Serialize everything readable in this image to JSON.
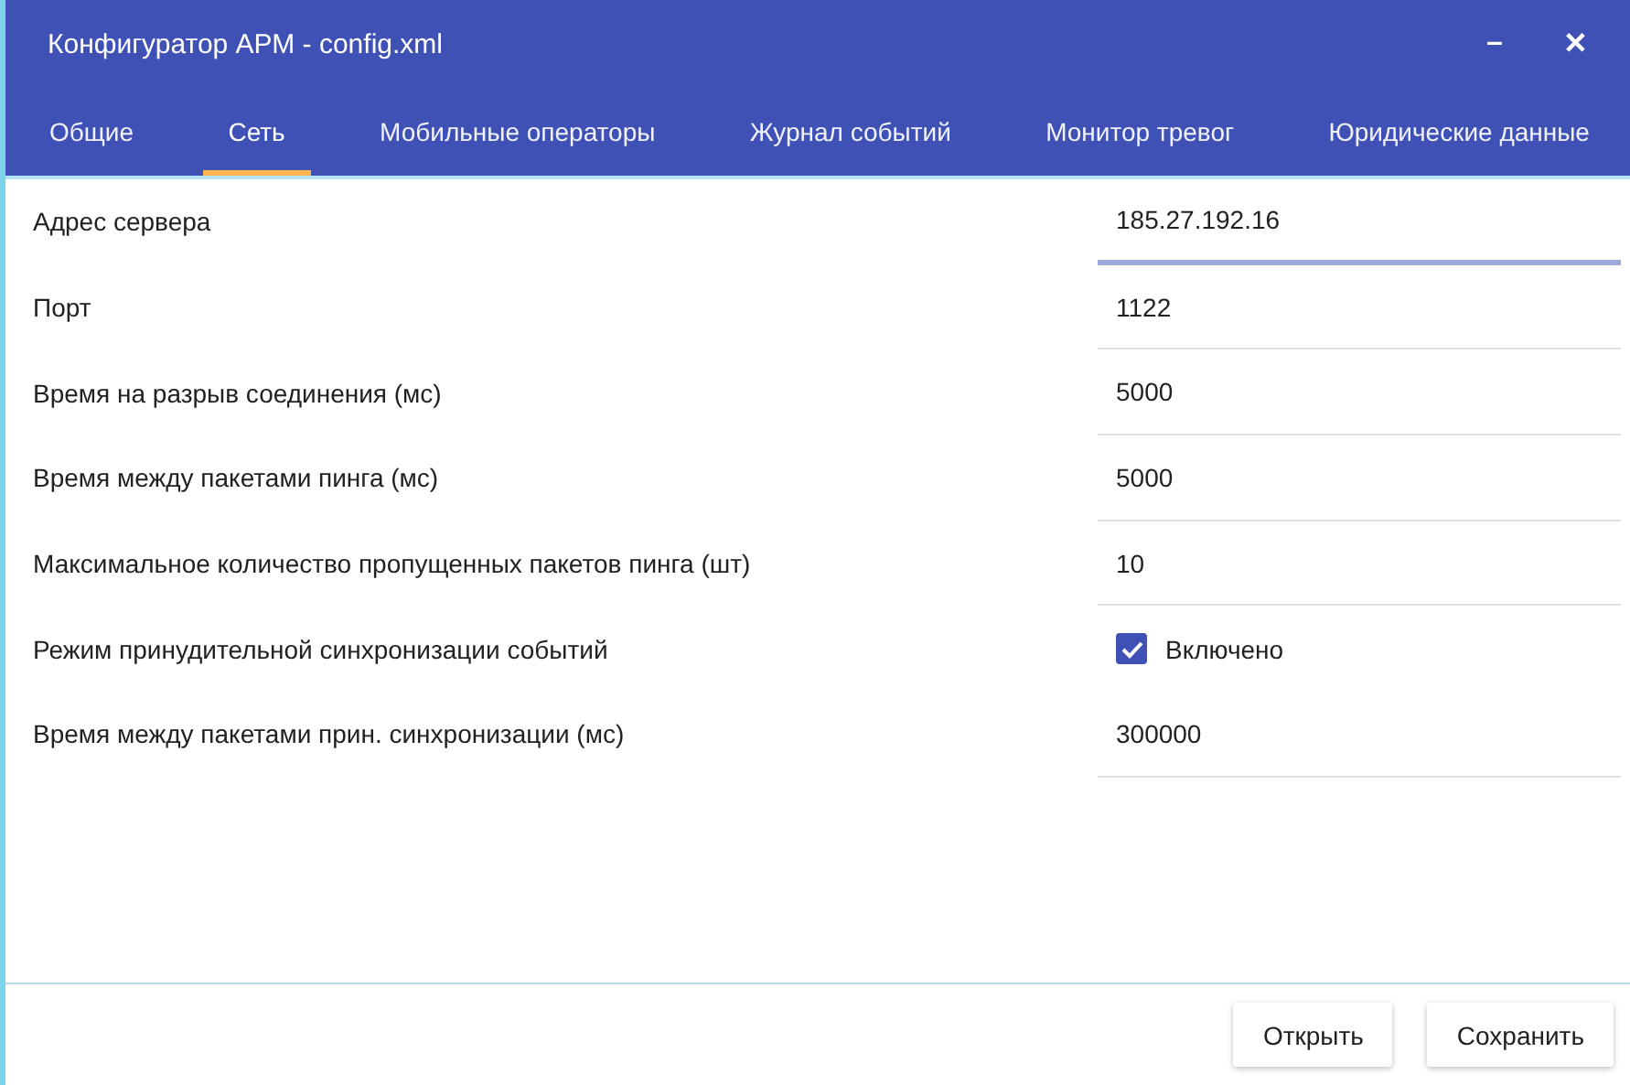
{
  "window": {
    "title": "Конфигуратор АРМ - config.xml",
    "controls": [
      "–",
      "✕"
    ]
  },
  "tabs": [
    {
      "label": "Общие",
      "selected": false
    },
    {
      "label": "Сеть",
      "selected": true
    },
    {
      "label": "Мобильные операторы",
      "selected": false
    },
    {
      "label": "Журнал событий",
      "selected": false
    },
    {
      "label": "Монитор тревог",
      "selected": false
    },
    {
      "label": "Юридические данные",
      "selected": false
    }
  ],
  "settings": [
    {
      "label": "Адрес сервера",
      "kind": "text",
      "value": "185.27.192.16",
      "focused": true
    },
    {
      "label": "Порт",
      "kind": "text",
      "value": "1122",
      "focused": false
    },
    {
      "label": "Время на разрыв соединения (мс)",
      "kind": "text",
      "value": "5000",
      "focused": false
    },
    {
      "label": "Время между пакетами пинга (мс)",
      "kind": "text",
      "value": "5000",
      "focused": false
    },
    {
      "label": "Максимальное количество пропущенных пакетов пинга (шт)",
      "kind": "text",
      "value": "10",
      "focused": false
    },
    {
      "label": "Режим принудительной синхронизации событий",
      "kind": "checkbox",
      "value": "Включено",
      "checked": true
    },
    {
      "label": "Время между пакетами прин. синхронизации (мс)",
      "kind": "text",
      "value": "300000",
      "focused": false
    }
  ],
  "buttons": [
    "Открыть",
    "Сохранить"
  ]
}
